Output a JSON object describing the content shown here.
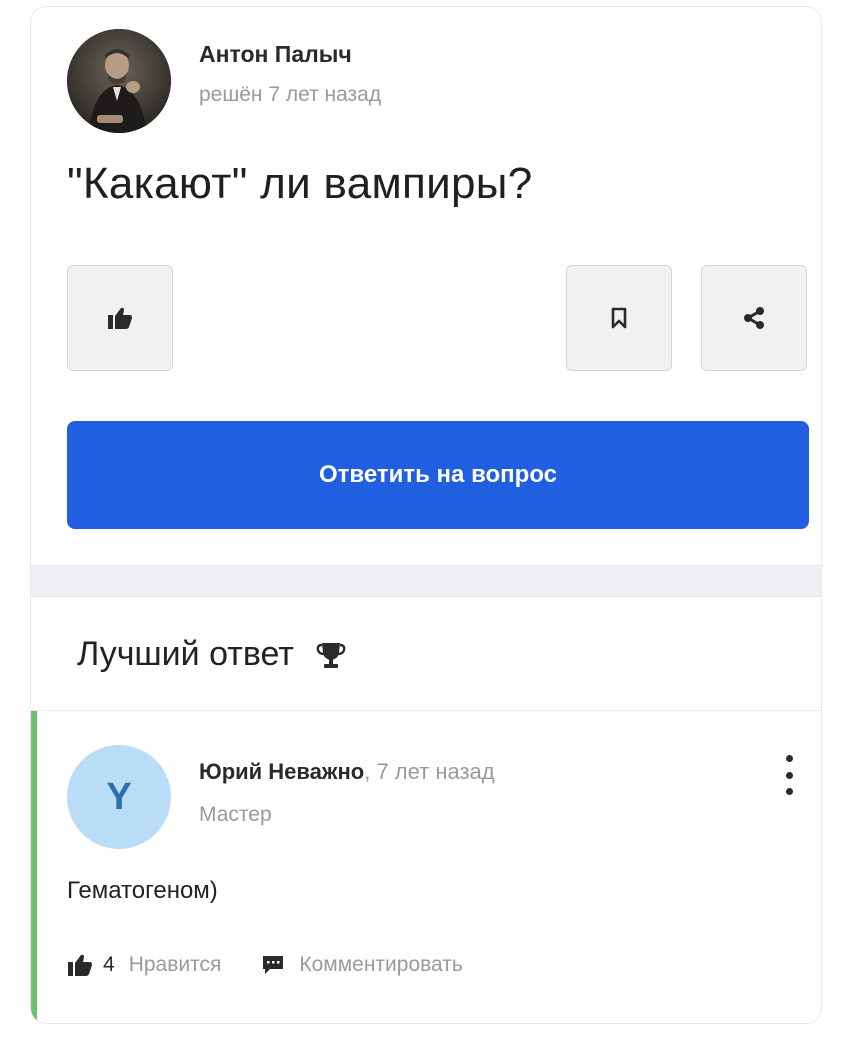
{
  "question": {
    "author": "Антон Палыч",
    "time": "решён 7 лет назад",
    "title": "\"Какают\" ли вампиры?",
    "answer_button": "Ответить на вопрос",
    "icons": [
      "like-icon",
      "bookmark-icon",
      "share-icon"
    ]
  },
  "best_answer": {
    "heading": "Лучший ответ",
    "heading_icon": "trophy-icon",
    "avatar_letter": "Y",
    "author": "Юрий Неважно",
    "time": ", 7 лет назад",
    "rank": "Мастер",
    "text": "Гематогеном)",
    "likes": "4",
    "like_label": "Нравится",
    "comment_label": "Комментировать"
  },
  "colors": {
    "accent_blue": "#1f5fe0",
    "answer_accent_green": "#6cc070",
    "avatar_bg": "#b9dcf7"
  }
}
